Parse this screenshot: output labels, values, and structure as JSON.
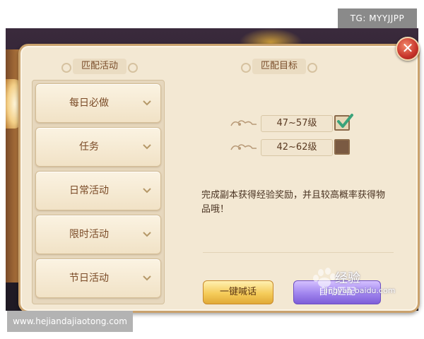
{
  "watermarks": {
    "top": "TG: MYYJJPP",
    "bottom": "www.hejiandajiaotong.com",
    "baidu_main": "经验",
    "baidu_sub": "jingyan.baidu.com"
  },
  "dialog": {
    "left_title": "匹配活动",
    "right_title": "匹配目标",
    "menu": [
      {
        "label": "每日必做"
      },
      {
        "label": "任务"
      },
      {
        "label": "日常活动"
      },
      {
        "label": "限时活动"
      },
      {
        "label": "节日活动"
      }
    ],
    "targets": [
      {
        "label": "47~57级",
        "checked": true
      },
      {
        "label": "42~62级",
        "checked": false
      }
    ],
    "description": "完成副本获得经验奖励，并且较高概率获得物品哦！",
    "shout_button": "一键喊话",
    "auto_match_button": "自动匹配"
  },
  "colors": {
    "panel_bg": "#f3e8d3",
    "accent_gold": "#f5cc5a",
    "accent_purple": "#a084ee",
    "close_red": "#c6332a"
  },
  "icons": {
    "close": "close-icon",
    "chevron": "chevron-down-icon",
    "check": "checkmark-icon",
    "cloud": "cloud-ornament-icon"
  }
}
